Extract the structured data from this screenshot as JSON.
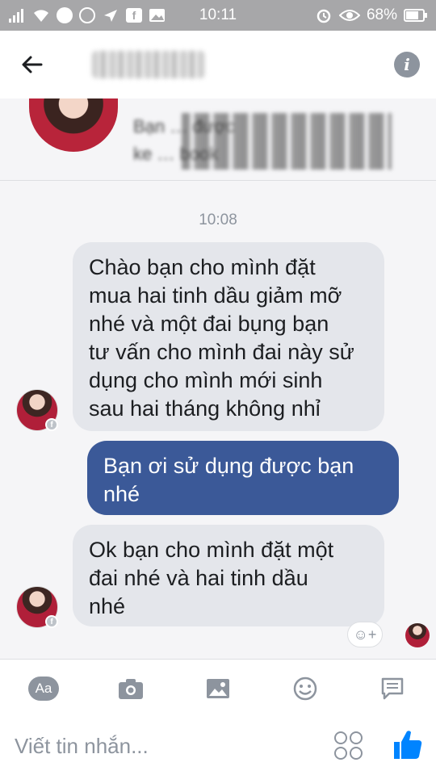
{
  "status_bar": {
    "time": "10:11",
    "battery": "68%",
    "app_icons": [
      "signal-icon",
      "wifi-icon",
      "messenger-icon",
      "compass-icon",
      "navigation-icon",
      "facebook-icon",
      "gallery-icon"
    ],
    "right_icons": [
      "alarm-icon",
      "eye-icon",
      "battery-icon"
    ]
  },
  "header": {
    "back_icon": "arrow-left-icon",
    "info_label": "i"
  },
  "profile_card": {
    "text_line1": "Bạn … được",
    "text_line2": "ke … book"
  },
  "conversation": {
    "timestamp": "10:08",
    "messages": [
      {
        "direction": "incoming",
        "lines": [
          "Chào bạn cho mình đặt",
          "mua hai tinh dầu giảm mỡ",
          "nhé và một đai bụng bạn",
          "tư vấn cho mình đai này sử",
          "dụng cho mình mới sinh",
          "sau hai tháng không nhỉ"
        ]
      },
      {
        "direction": "outgoing",
        "lines": [
          "Bạn ơi sử dụng được bạn",
          "nhé"
        ]
      },
      {
        "direction": "incoming",
        "lines": [
          "Ok bạn cho mình đặt một",
          "đai nhé  và hai tinh dầu",
          "nhé"
        ]
      }
    ],
    "react_label": "☺+"
  },
  "toolbar": {
    "aa_label": "Aa",
    "icons": [
      "text-format-icon",
      "camera-icon",
      "image-icon",
      "emoji-icon",
      "chat-extension-icon"
    ]
  },
  "compose": {
    "placeholder": "Viết tin nhắn...",
    "value": ""
  },
  "colors": {
    "outgoing_bubble": "#3b5998",
    "incoming_bubble": "#e4e6eb",
    "like": "#0084ff",
    "status_bar": "#a7a7a9"
  }
}
